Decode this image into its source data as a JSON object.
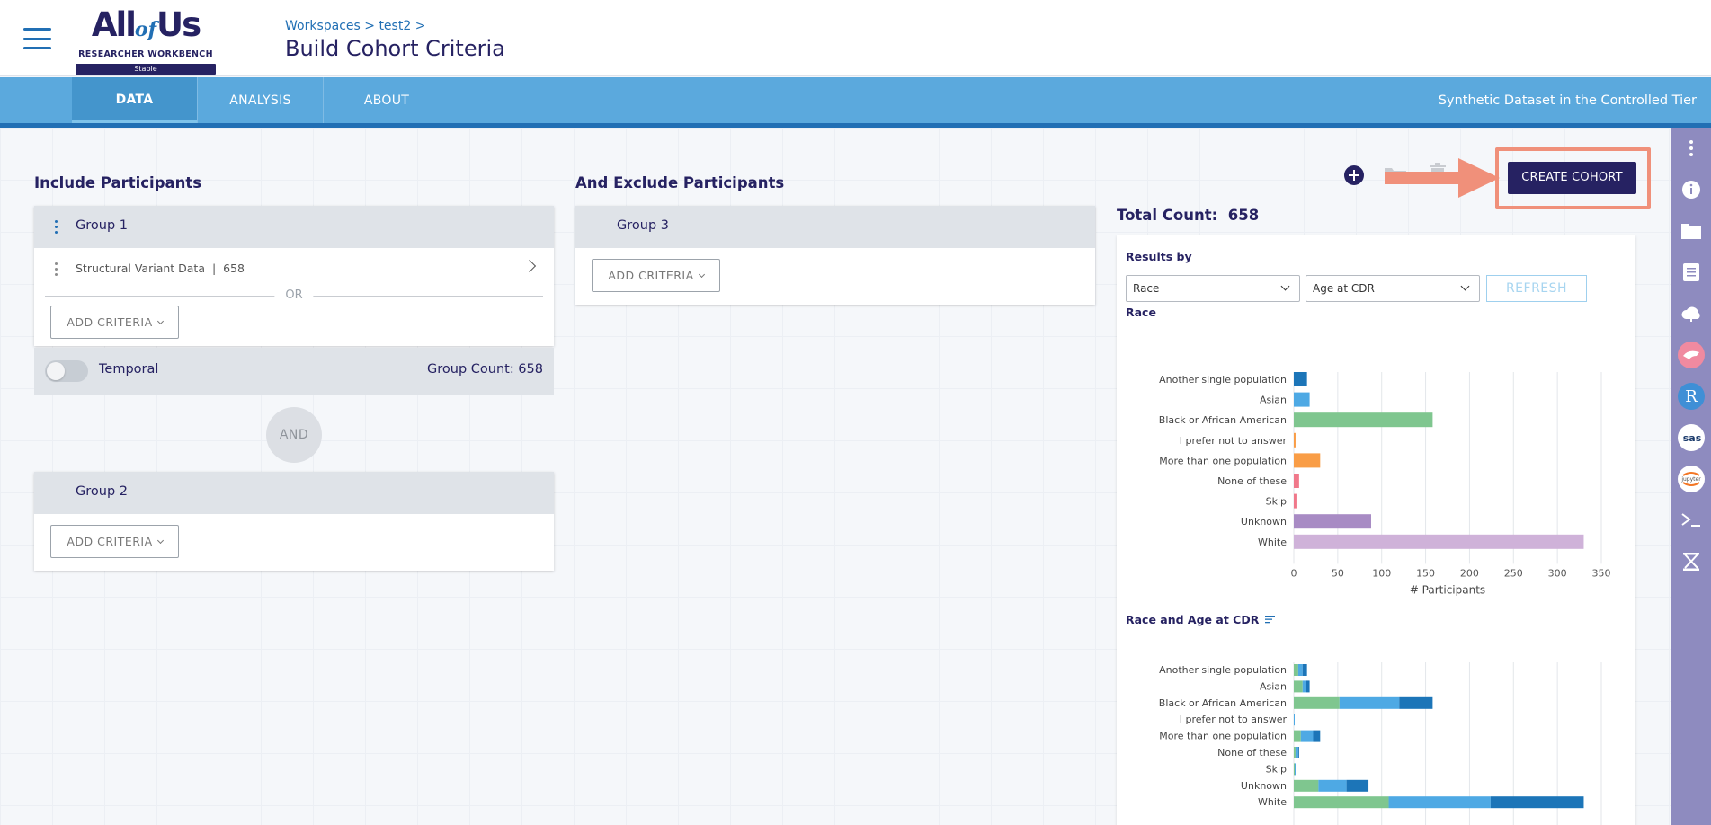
{
  "header": {
    "logo": {
      "line1_a": "All",
      "line1_b": "of",
      "line1_c": "Us",
      "line2": "RESEARCHER WORKBENCH",
      "badge": "Stable"
    },
    "breadcrumb": "Workspaces > test2 >",
    "title": "Build Cohort Criteria"
  },
  "nav": {
    "tabs": [
      {
        "label": "DATA",
        "active": true
      },
      {
        "label": "ANALYSIS",
        "active": false
      },
      {
        "label": "ABOUT",
        "active": false
      }
    ],
    "tier_label": "Synthetic Dataset in the Controlled Tier"
  },
  "include": {
    "section_title": "Include Participants",
    "group1": {
      "title": "Group 1",
      "criteria": "Structural Variant Data  |  658",
      "or_label": "OR",
      "add_label": "ADD CRITERIA",
      "temporal_label": "Temporal",
      "group_count": "Group Count: 658"
    },
    "and_label": "AND",
    "group2": {
      "title": "Group 2",
      "add_label": "ADD CRITERIA"
    }
  },
  "exclude": {
    "section_title": "And Exclude Participants",
    "group3": {
      "title": "Group 3",
      "add_label": "ADD CRITERIA"
    }
  },
  "toolbar": {
    "create_cohort_label": "CREATE COHORT"
  },
  "results": {
    "total_count": "Total Count:  658",
    "results_by_label": "Results by",
    "select1": "Race",
    "select2": "Age at CDR",
    "refresh_label": "REFRESH",
    "chart1_title": "Race",
    "chart2_title": "Race and Age at CDR"
  },
  "colors": {
    "navy": "#262262",
    "blue": "#216fb4",
    "light_blue": "#5ba9dd",
    "green": "#7fc68f",
    "orange": "#f99d46",
    "pink": "#f0788a",
    "purple": "#a88bc4",
    "lavender": "#cfb2d9",
    "dark_blue": "#1c75b8",
    "sky": "#4ea9e4",
    "arrow": "#f0907a"
  },
  "rail_icons": [
    "more-vert-icon",
    "info-icon",
    "folder-icon",
    "notebook-icon",
    "cloud-cost-icon",
    "cromwell-icon",
    "r-icon",
    "sas-icon",
    "jupyter-icon",
    "terminal-icon",
    "genomics-icon"
  ],
  "chart_data": [
    {
      "type": "bar",
      "orientation": "horizontal",
      "title": "Race",
      "categories": [
        "Another single population",
        "Asian",
        "Black or African American",
        "I prefer not to answer",
        "More than one population",
        "None of these",
        "Skip",
        "Unknown",
        "White"
      ],
      "values": [
        15,
        18,
        158,
        2,
        30,
        6,
        3,
        88,
        330
      ],
      "colors": [
        "#1c75b8",
        "#4ea9e4",
        "#7fc68f",
        "#f99d46",
        "#f99d46",
        "#f0788a",
        "#f0788a",
        "#a88bc4",
        "#cfb2d9"
      ],
      "xlabel": "# Participants",
      "xlim": [
        0,
        350
      ],
      "xticks": [
        0,
        50,
        100,
        150,
        200,
        250,
        300,
        350
      ]
    },
    {
      "type": "bar",
      "orientation": "horizontal",
      "stacked": true,
      "title": "Race and Age at CDR",
      "categories": [
        "Another single population",
        "Asian",
        "Black or African American",
        "I prefer not to answer",
        "More than one population",
        "None of these",
        "Skip",
        "Unknown",
        "White"
      ],
      "series": [
        {
          "color": "#7fc68f",
          "values": [
            5,
            10,
            52,
            0,
            8,
            2,
            1,
            28,
            108
          ]
        },
        {
          "color": "#4ea9e4",
          "values": [
            5,
            4,
            68,
            1,
            14,
            3,
            1,
            32,
            116
          ]
        },
        {
          "color": "#1c75b8",
          "values": [
            5,
            4,
            38,
            0,
            8,
            1,
            0,
            25,
            106
          ]
        }
      ],
      "xlim": [
        0,
        350
      ]
    }
  ]
}
